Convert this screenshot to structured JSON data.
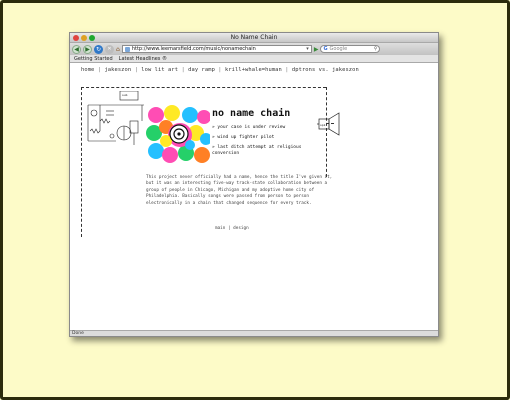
{
  "window": {
    "title": "No Name Chain"
  },
  "toolbar": {
    "url": "http://www.leemarsfield.com/music/nonamechain",
    "search_placeholder": "Google"
  },
  "bookmarks": [
    "Getting Started",
    "Latest Headlines ®"
  ],
  "page": {
    "nav": [
      "home",
      "jakeszon",
      "low lit art",
      "day ramp",
      "krill+whale=human",
      "dptrons vs. jakeszon"
    ],
    "title": "no name chain",
    "tracks": [
      "» your case is under review",
      "» wind up fighter pilot",
      "» last ditch attempt at religious conversion"
    ],
    "description": "This project never officially had a name, hence the title I've given it, but it was an interesting five-way track-state collaboration between a group of people in Chicago, Michigan and my adoptive home city of Philadelphia. Basically songs were passed from person to person electronically in a chain that changed sequence for every track.",
    "footer_links": [
      "main",
      "design"
    ],
    "footer_sep": "|"
  },
  "status": {
    "text": "Done"
  },
  "colors": {
    "page_background": "#fdfbc8",
    "frame_border": "#2b2b0c"
  }
}
